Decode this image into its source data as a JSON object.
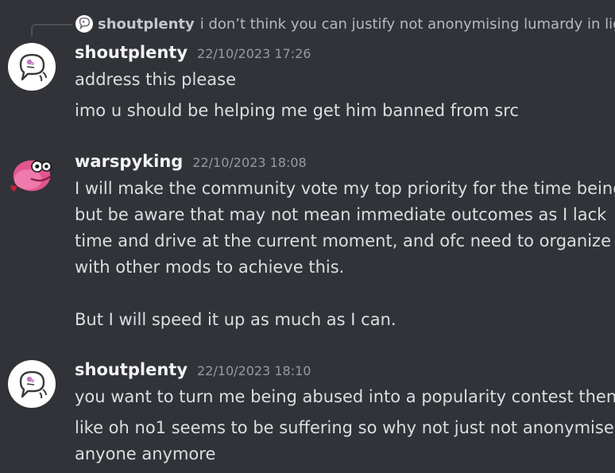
{
  "reply": {
    "username": "shoutplenty",
    "text": "i don’t think you can justify not anonymising lumardy in light"
  },
  "messages": [
    {
      "username": "shoutplenty",
      "timestamp": "22/10/2023 17:26",
      "lines": [
        "address this please",
        "imo u should be helping me get him banned from src"
      ]
    },
    {
      "username": "warspyking",
      "timestamp": "22/10/2023 18:08",
      "lines": [
        "I will make the community vote my top priority for the time being,",
        "but be aware that may not mean immediate outcomes as I lack",
        "time and drive at the current moment, and ofc need to organize",
        "with other mods to achieve this.",
        "But I will speed it up as much as I can."
      ]
    },
    {
      "username": "shoutplenty",
      "timestamp": "22/10/2023 18:10",
      "lines": [
        "you want to turn me being abused into a popularity contest then",
        "like oh no1 seems to be suffering so why not just not anonymise",
        "anyone anymore"
      ]
    }
  ]
}
